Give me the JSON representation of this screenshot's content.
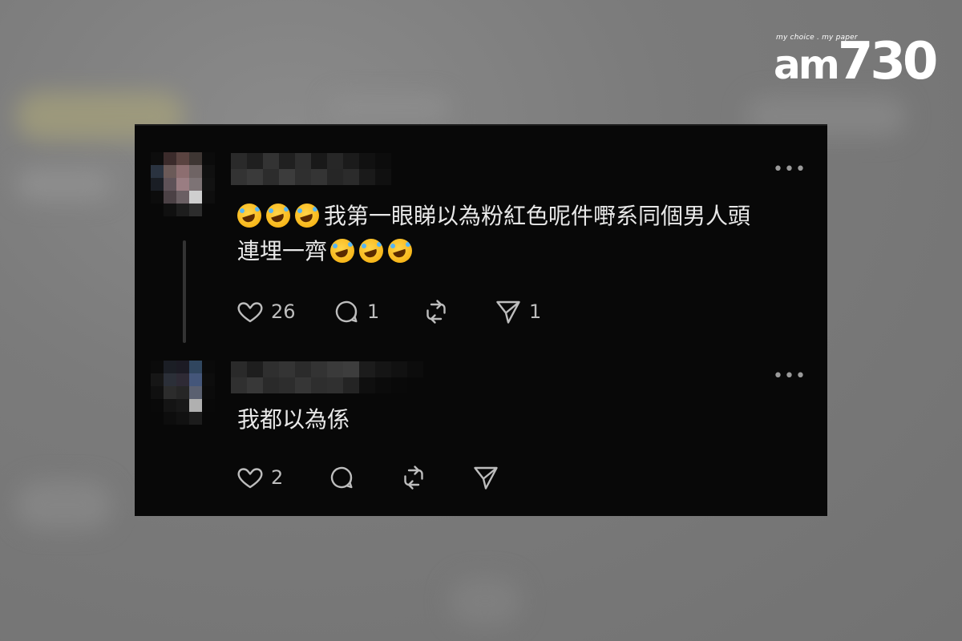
{
  "logo": {
    "tagline": "my choice . my paper",
    "brand_prefix": "am",
    "brand_number": "730"
  },
  "posts": [
    {
      "text_prefix": "我第一眼睇以為粉紅色呢件嘢系同個男人頭",
      "text_line2": "連埋一齊",
      "emoji": "rolling-on-floor-laughing",
      "likes": "26",
      "replies": "1",
      "shares": "1"
    },
    {
      "text": "我都以為係",
      "likes": "2"
    }
  ],
  "icons": [
    "heart-icon",
    "comment-icon",
    "repost-icon",
    "share-icon",
    "more-icon"
  ],
  "colors": {
    "card_bg": "#080808",
    "text": "#e8e8e8",
    "icon": "#bdbdbd",
    "backdrop": "#7a7a7a"
  }
}
